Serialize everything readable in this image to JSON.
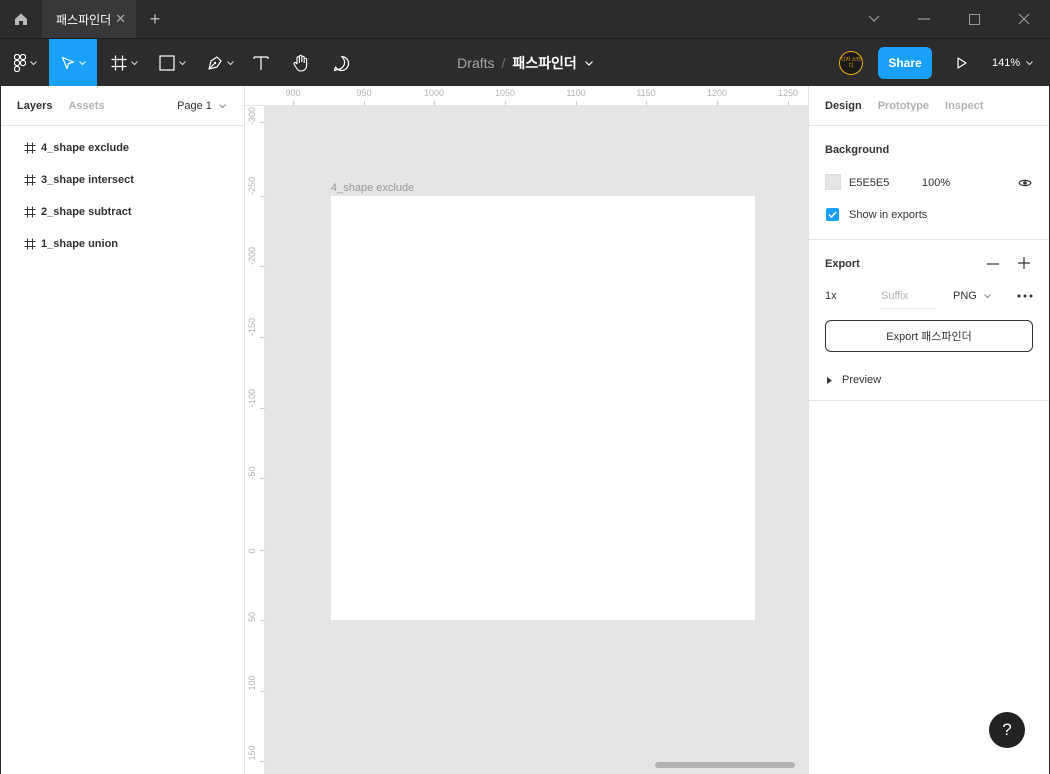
{
  "titlebar": {
    "tab_title": "패스파인더",
    "tab_close": "✕",
    "new_tab": "+"
  },
  "toolbar": {
    "breadcrumb_drafts": "Drafts",
    "breadcrumb_sep": "/",
    "file_name": "패스파인더",
    "avatar_text": "디자 스터디",
    "share_label": "Share",
    "zoom_level": "141%"
  },
  "left_panel": {
    "tab_layers": "Layers",
    "tab_assets": "Assets",
    "page_selector": "Page 1",
    "layers": [
      {
        "name": "4_shape exclude"
      },
      {
        "name": "3_shape intersect"
      },
      {
        "name": "2_shape subtract"
      },
      {
        "name": "1_shape union"
      }
    ]
  },
  "rulers": {
    "top": [
      "900",
      "950",
      "1000",
      "1050",
      "1100",
      "1150",
      "1200",
      "1250"
    ],
    "left": [
      "-300",
      "-250",
      "-200",
      "-150",
      "-100",
      "-50",
      "0",
      "50",
      "100",
      "150"
    ]
  },
  "canvas": {
    "frame_label": "4_shape exclude",
    "background_color": "#E5E5E5"
  },
  "right_panel": {
    "tab_design": "Design",
    "tab_prototype": "Prototype",
    "tab_inspect": "Inspect",
    "background": {
      "title": "Background",
      "hex": "E5E5E5",
      "opacity": "100%",
      "show_in_exports": "Show in exports"
    },
    "export": {
      "title": "Export",
      "scale": "1x",
      "suffix_placeholder": "Suffix",
      "format": "PNG",
      "button_label": "Export 패스파인더",
      "preview_label": "Preview"
    }
  },
  "help": {
    "label": "?"
  },
  "colors": {
    "accent": "#18A0FB",
    "toolbar_bg": "#2C2C2C",
    "canvas_bg": "#E5E5E5"
  }
}
